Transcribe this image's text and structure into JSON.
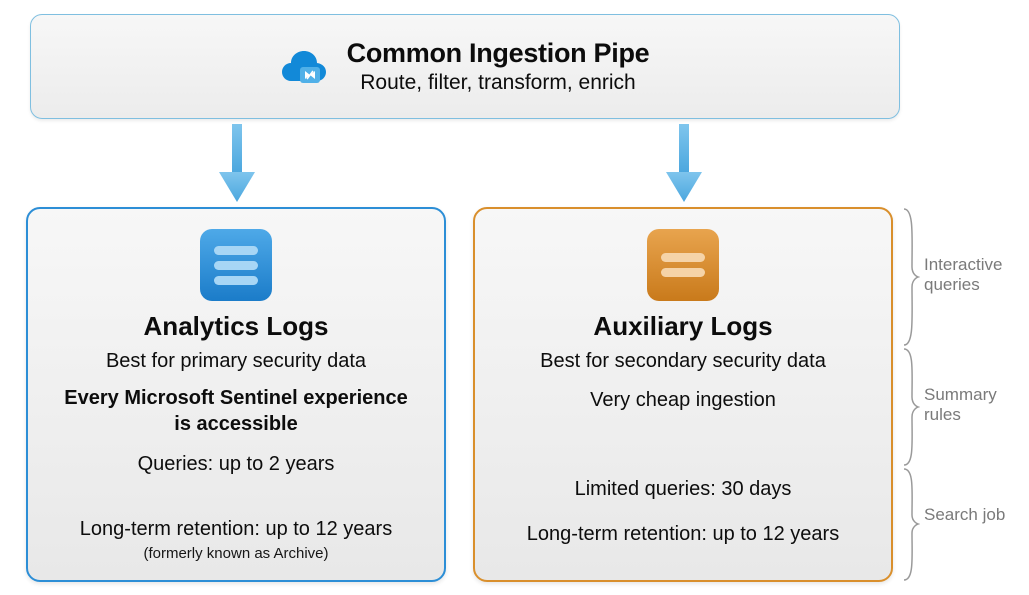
{
  "top": {
    "title": "Common Ingestion Pipe",
    "subtitle": "Route, filter, transform, enrich"
  },
  "analytics": {
    "title": "Analytics Logs",
    "sub1": "Best for primary security data",
    "emph": "Every Microsoft Sentinel experience is accessible",
    "queries": "Queries: up to 2 years",
    "retention": "Long-term retention: up to 12 years",
    "note": "(formerly known as Archive)"
  },
  "auxiliary": {
    "title": "Auxiliary Logs",
    "sub1": "Best for secondary security data",
    "sub2": "Very cheap ingestion",
    "queries": "Limited queries: 30 days",
    "retention": "Long-term retention: up to 12 years"
  },
  "sidebar": {
    "label1": "Interactive queries",
    "label2": "Summary rules",
    "label3": "Search job"
  }
}
